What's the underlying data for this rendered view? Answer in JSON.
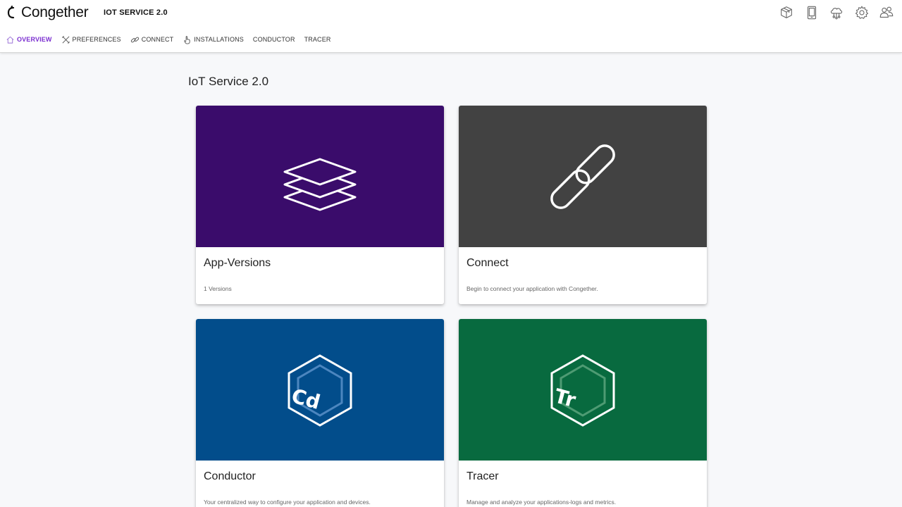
{
  "header": {
    "brand": "Congether",
    "service_title": "IOT SERVICE 2.0",
    "icons": [
      "package-icon",
      "tablet-icon",
      "cloud-network-icon",
      "gear-icon",
      "users-icon"
    ]
  },
  "nav": {
    "items": [
      {
        "label": "OVERVIEW",
        "icon": "home-icon",
        "active": true
      },
      {
        "label": "PREFERENCES",
        "icon": "tools-icon",
        "active": false
      },
      {
        "label": "CONNECT",
        "icon": "link-icon",
        "active": false
      },
      {
        "label": "INSTALLATIONS",
        "icon": "hand-pointer-icon",
        "active": false
      },
      {
        "label": "CONDUCTOR",
        "icon": "",
        "active": false
      },
      {
        "label": "TRACER",
        "icon": "",
        "active": false
      }
    ]
  },
  "page": {
    "title": "IoT Service 2.0"
  },
  "cards": [
    {
      "title": "App-Versions",
      "description": "1 Versions",
      "icon": "layers-icon",
      "color": "#3a0c6b"
    },
    {
      "title": "Connect",
      "description": "Begin to connect your application with Congether.",
      "icon": "link-icon",
      "color": "#424242"
    },
    {
      "title": "Conductor",
      "description": "Your centralized way to configure your application and devices.",
      "icon": "conductor-hexagon-icon",
      "icon_text": "Cd",
      "color": "#024d8b"
    },
    {
      "title": "Tracer",
      "description": "Manage and analyze your applications-logs and metrics.",
      "icon": "tracer-hexagon-icon",
      "icon_text": "Tr",
      "color": "#086a3f"
    }
  ],
  "colors": {
    "accent": "#7b2fd0",
    "background": "#f7f8fa"
  }
}
